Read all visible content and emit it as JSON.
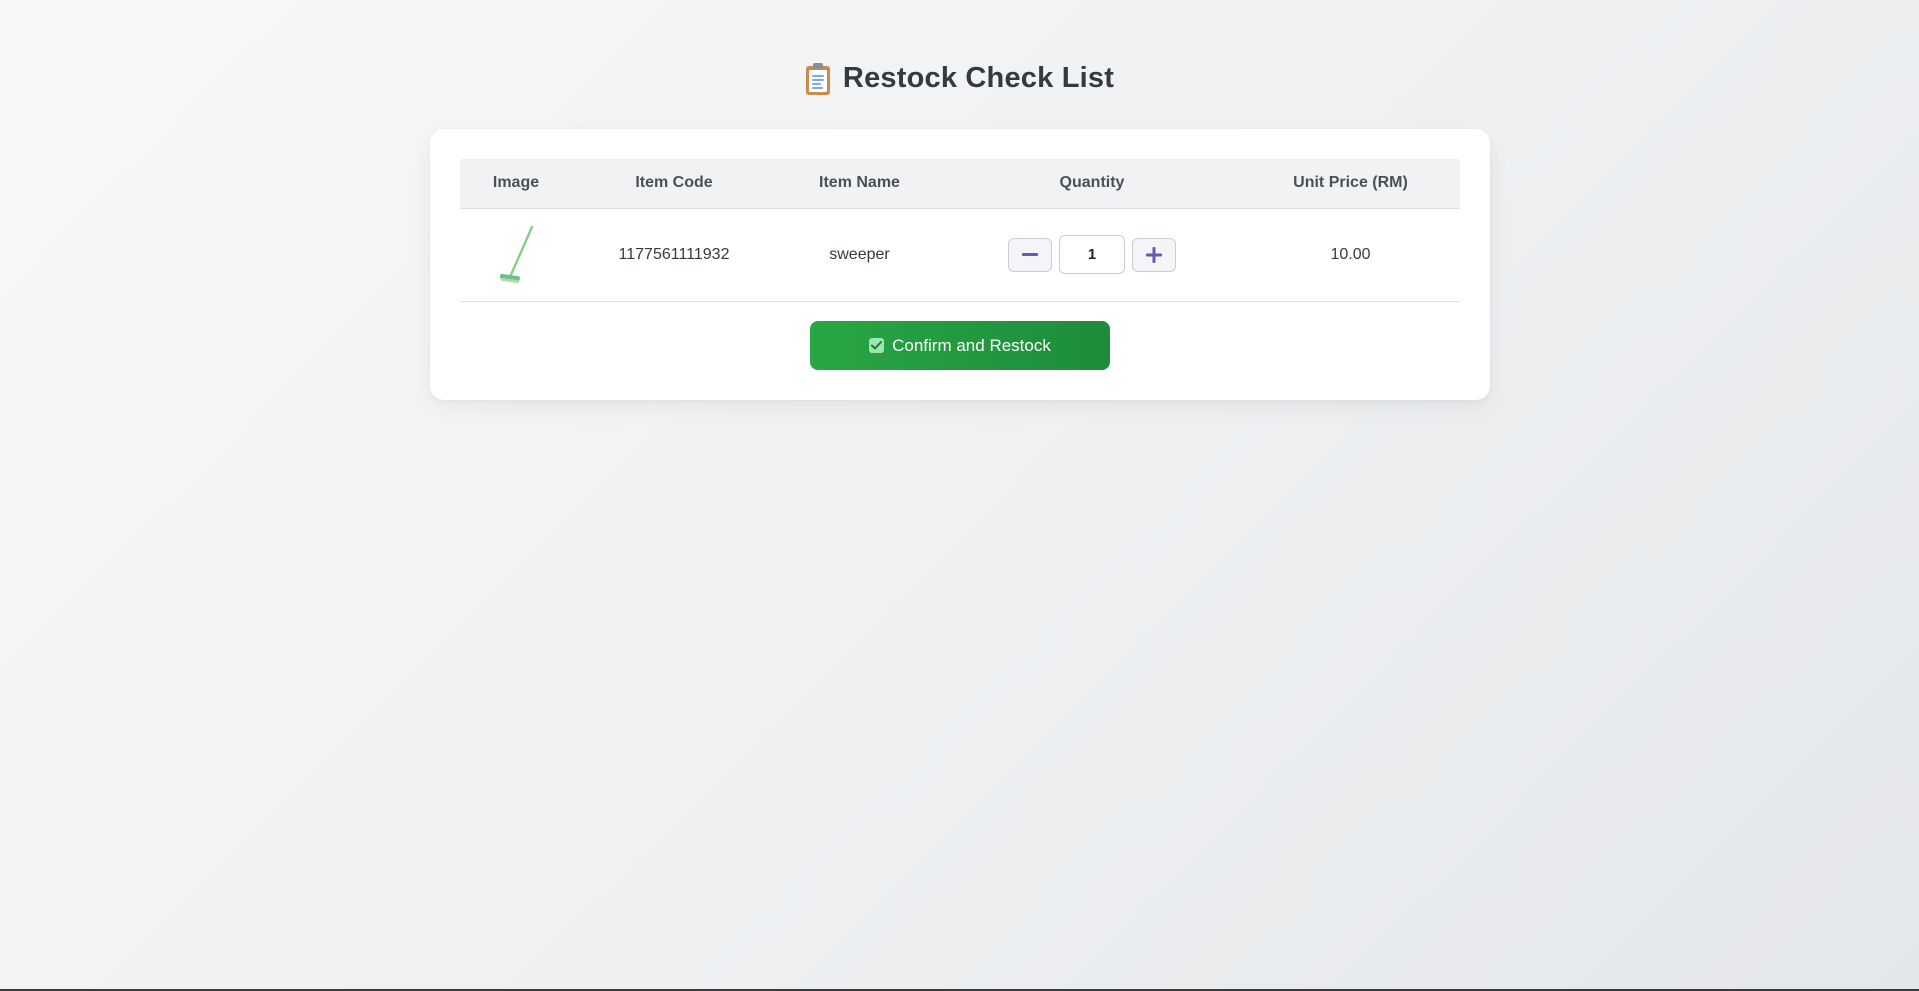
{
  "header": {
    "title": "Restock Check List",
    "icon": "clipboard-icon"
  },
  "table": {
    "columns": [
      "Image",
      "Item Code",
      "Item Name",
      "Quantity",
      "Unit Price (RM)"
    ],
    "rows": [
      {
        "image_icon": "broom-icon",
        "item_code": "1177561111932",
        "item_name": "sweeper",
        "quantity": "1",
        "unit_price": "10.00"
      }
    ]
  },
  "quantity_controls": {
    "decrement_label": "−",
    "increment_label": "+"
  },
  "actions": {
    "confirm_label": "Confirm and Restock",
    "confirm_icon": "check-box-icon"
  },
  "colors": {
    "accent_green": "#28a745",
    "stepper_purple": "#6a55b8",
    "header_bg": "#f1f2f4"
  }
}
